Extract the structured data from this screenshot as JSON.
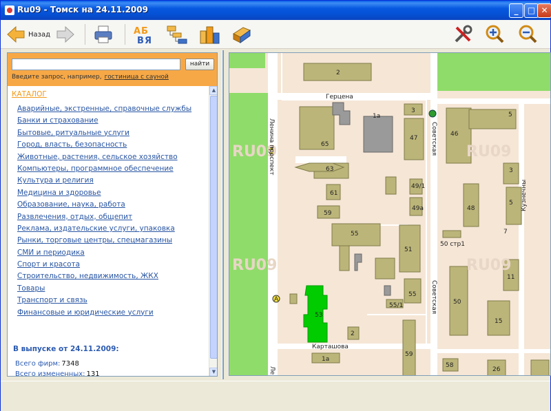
{
  "window": {
    "title": "Ru09 - Томск на 24.11.2009"
  },
  "toolbar": {
    "back_label": "Назад"
  },
  "search": {
    "button": "найти",
    "hint": "Введите запрос, например,",
    "hint_link": "гостиница с сауной",
    "value": ""
  },
  "catalog": {
    "title": "КАТАЛОГ",
    "items": [
      "Аварийные, экстренные, справочные службы",
      "Банки и страхование",
      "Бытовые, ритуальные услуги",
      "Город, власть, безопасность",
      "Животные, растения, сельское хозяйство",
      "Компьютеры, программное обеспечение",
      "Культура и религия",
      "Медицина и здоровье",
      "Образование, наука, работа",
      "Развлечения, отдых, общепит",
      "Реклама, издательские услуги, упаковка",
      "Рынки, торговые центры, спецмагазины",
      "СМИ и периодика",
      "Спорт и красота",
      "Строительство, недвижимость, ЖКХ",
      "Товары",
      "Транспорт и связь",
      "Финансовые и юридические услуги"
    ]
  },
  "issue": {
    "title": "В выпуске от 24.11.2009:",
    "total_label": "Всего фирм:",
    "total_value": "7348",
    "changed_label": "Всего измененных:",
    "changed_value": "131"
  },
  "map": {
    "streets": {
      "gertsena": "Герцена",
      "lenina": "Ленина проспект",
      "sovetskaya": "Советская",
      "kartashova": "Карташова",
      "kuznechny": "Кузнечны",
      "lenina_short": "Ле"
    },
    "watermark": "RU09",
    "buildings": {
      "b2": "2",
      "b1a": "1а",
      "b3": "3",
      "b65": "65",
      "b47": "47",
      "b46": "46",
      "b5": "5",
      "b63": "63",
      "b61": "61",
      "b491": "49/1",
      "b49a": "49а",
      "b59": "59",
      "b55": "55",
      "b51": "51",
      "b48": "48",
      "b3b": "3",
      "b5b": "5",
      "b7": "7",
      "b50s": "50 стр1",
      "b53": "53",
      "b551": "55/1",
      "b55b": "55",
      "b50": "50",
      "b11": "11",
      "b15": "15",
      "b2b": "2",
      "b1ab": "1а",
      "b59b": "59",
      "b58": "58",
      "b26": "26"
    }
  }
}
